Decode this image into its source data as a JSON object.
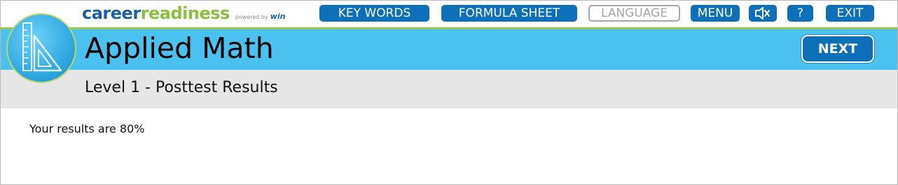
{
  "brand": {
    "career": "career",
    "readiness": "readiness",
    "powered_by": "powered by",
    "win": "win"
  },
  "toolbar": {
    "key_words": "KEY WORDS",
    "formula_sheet": "FORMULA SHEET",
    "language": "LANGUAGE",
    "menu": "MENU",
    "help": "?",
    "exit": "EXIT",
    "audio_icon": "speaker-muted-icon"
  },
  "header": {
    "title": "Applied Math",
    "logo_icon": "ruler-triangle-icon",
    "next": "NEXT"
  },
  "subheader": {
    "title": "Level 1 - Posttest Results"
  },
  "main": {
    "result_text": "Your results are 80%"
  },
  "colors": {
    "brand_blue": "#1b5faa",
    "brand_green": "#8bbf3f",
    "button_blue": "#0d6fb7",
    "title_band": "#4ac1ee",
    "subtitle_band": "#e6e6e6",
    "disabled_gray": "#a7a7a7"
  }
}
